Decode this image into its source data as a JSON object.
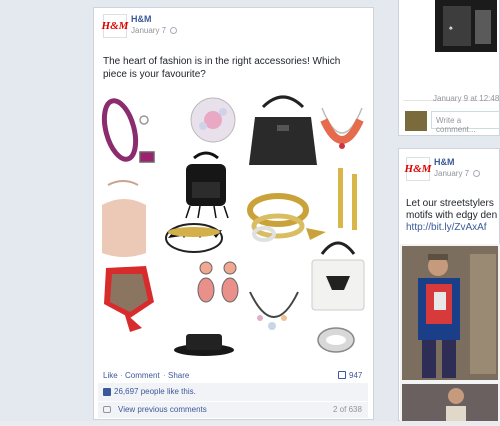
{
  "left_post": {
    "page_name": "H&M",
    "date": "January 7",
    "text": "The heart of fashion is in the right accessories! Which piece is your favourite?",
    "actions": {
      "like": "Like",
      "comment": "Comment",
      "share": "Share",
      "separator": "·"
    },
    "comment_count": "947",
    "likes": "26,697 people like this.",
    "view_previous": "View previous comments",
    "pager": "2 of 638"
  },
  "right_top": {
    "timestamp": "January 9 at 12:48",
    "input_placeholder": "Write a comment..."
  },
  "right_post": {
    "page_name": "H&M",
    "date": "January 7",
    "text_line1": "Let our streetstylers",
    "text_line2": "motifs with edgy den",
    "link": "http://bit.ly/ZvAxAf"
  },
  "brand": {
    "logo_text": "H&M",
    "accent": "#3b5998",
    "logo_red": "#dd0000"
  },
  "icons": [
    "globe-icon",
    "comment-icon",
    "like-icon",
    "speech-bubble-icon"
  ]
}
